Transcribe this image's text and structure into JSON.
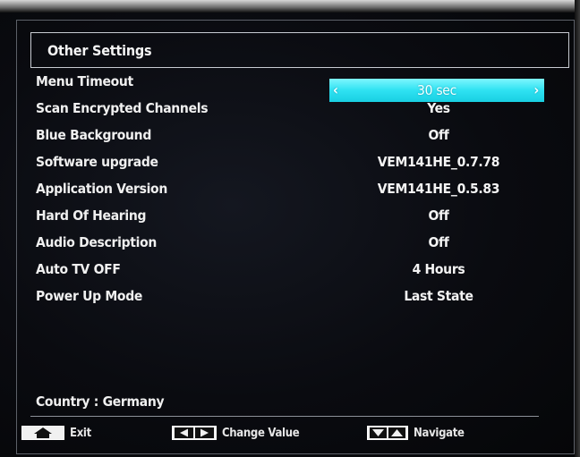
{
  "menu": {
    "title": "Other Settings",
    "selected_index": 0,
    "items": [
      {
        "label": "Menu Timeout",
        "value": "30 sec"
      },
      {
        "label": "Scan Encrypted Channels",
        "value": "Yes"
      },
      {
        "label": "Blue Background",
        "value": "Off"
      },
      {
        "label": "Software upgrade",
        "value": "VEM141HE_0.7.78"
      },
      {
        "label": "Application Version",
        "value": "VEM141HE_0.5.83"
      },
      {
        "label": "Hard Of Hearing",
        "value": "Off"
      },
      {
        "label": "Audio Description",
        "value": "Off"
      },
      {
        "label": "Auto TV OFF",
        "value": "4 Hours"
      },
      {
        "label": "Power Up Mode",
        "value": "Last State"
      }
    ],
    "country": "Country : Germany"
  },
  "footer": {
    "exit_label": "Exit",
    "exit_icon": "home-icon",
    "change_value_label": "Change Value",
    "change_value_icon": "left-right-arrows-icon",
    "navigate_label": "Navigate",
    "navigate_icon": "down-up-arrows-icon"
  },
  "colors": {
    "highlight": "#2fe2f2",
    "background": "#0a0b10",
    "text": "#f2f2f2"
  }
}
